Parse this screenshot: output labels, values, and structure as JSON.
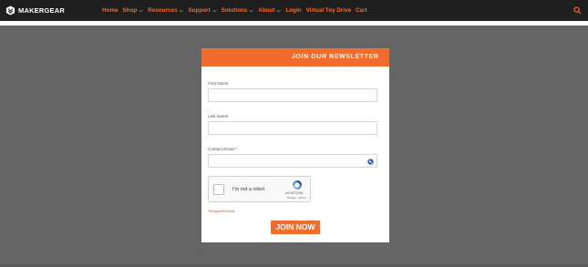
{
  "brand": {
    "name": "MAKERGEAR"
  },
  "nav": {
    "items": [
      {
        "label": "Home",
        "dropdown": false
      },
      {
        "label": "Shop",
        "dropdown": true
      },
      {
        "label": "Resources",
        "dropdown": true
      },
      {
        "label": "Support",
        "dropdown": true
      },
      {
        "label": "Solutions",
        "dropdown": true
      },
      {
        "label": "About",
        "dropdown": true
      },
      {
        "label": "Login",
        "dropdown": false
      },
      {
        "label": "Virtual Toy Drive",
        "dropdown": false
      },
      {
        "label": "Cart",
        "dropdown": false
      }
    ],
    "search_icon": "search-icon"
  },
  "newsletter": {
    "title": "JOIN OUR NEWSLETTER",
    "fields": {
      "first_name": {
        "label": "First Name",
        "value": ""
      },
      "last_name": {
        "label": "Last Name",
        "value": ""
      },
      "email": {
        "label": "Contact Email",
        "required_mark": "*",
        "value": ""
      }
    },
    "captcha": {
      "label": "I'm not a robot",
      "brand": "reCAPTCHA",
      "links": "Privacy - Terms"
    },
    "required_note": "*Required Fields",
    "submit_label": "JOIN NOW"
  },
  "colors": {
    "accent": "#f26c2e",
    "topbar": "#1f1f1f",
    "overlay": "#656565"
  }
}
